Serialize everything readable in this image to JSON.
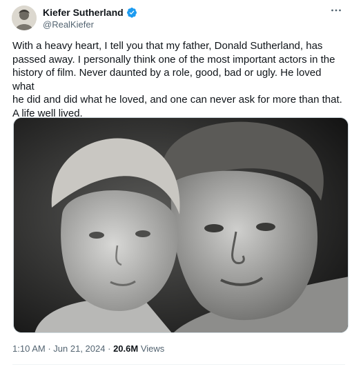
{
  "author": {
    "display_name": "Kiefer Sutherland",
    "handle": "@RealKiefer",
    "verified": true
  },
  "icons": {
    "verified": "verified-badge-icon",
    "more": "more-horizontal-icon"
  },
  "tweet": {
    "text": "With a heavy heart, I tell you that my father, Donald Sutherland, has\npassed away. I personally think one of the most important actors in the\nhistory of film. Never daunted by a role, good, bad or ugly. He loved what\nhe did and did what he loved, and one can never ask for more than that.\nA life well lived."
  },
  "meta": {
    "time": "1:10 AM",
    "separator": "·",
    "date": "Jun 21, 2024",
    "views_count": "20.6M",
    "views_label": "Views"
  },
  "colors": {
    "verified_blue": "#1d9bf0",
    "text_primary": "#0f1419",
    "text_secondary": "#536471"
  }
}
